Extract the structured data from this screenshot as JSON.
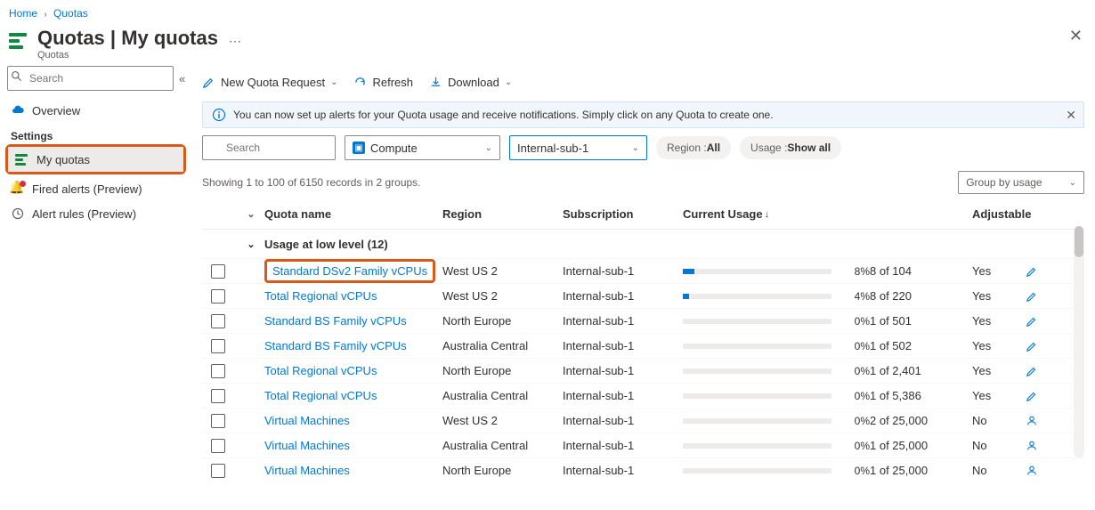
{
  "breadcrumb": {
    "home": "Home",
    "current": "Quotas"
  },
  "header": {
    "title": "Quotas",
    "subtitle_sep": " | ",
    "subtitle": "My quotas",
    "subheader": "Quotas"
  },
  "sidebar": {
    "search_placeholder": "Search",
    "overview": "Overview",
    "settings_header": "Settings",
    "my_quotas": "My quotas",
    "fired_alerts": "Fired alerts (Preview)",
    "alert_rules": "Alert rules (Preview)"
  },
  "toolbar": {
    "new_quota": "New Quota Request",
    "refresh": "Refresh",
    "download": "Download"
  },
  "banner": "You can now set up alerts for your Quota usage and receive notifications. Simply click on any Quota to create one.",
  "filters": {
    "search_placeholder": "Search",
    "category": "Compute",
    "subscription": "Internal-sub-1",
    "region_label": "Region : ",
    "region_value": "All",
    "usage_label": "Usage : ",
    "usage_value": "Show all"
  },
  "records_line": "Showing 1 to 100 of 6150 records in 2 groups.",
  "group_by": "Group by usage",
  "columns": {
    "name": "Quota name",
    "region": "Region",
    "subscription": "Subscription",
    "usage": "Current Usage",
    "adjustable": "Adjustable"
  },
  "group1": "Usage at low level (12)",
  "rows": [
    {
      "name": "Standard DSv2 Family vCPUs",
      "region": "West US 2",
      "sub": "Internal-sub-1",
      "pct": "8%",
      "fill": 8,
      "of": "8 of 104",
      "adj": "Yes",
      "icon": "pencil",
      "hl": true
    },
    {
      "name": "Total Regional vCPUs",
      "region": "West US 2",
      "sub": "Internal-sub-1",
      "pct": "4%",
      "fill": 4,
      "of": "8 of 220",
      "adj": "Yes",
      "icon": "pencil"
    },
    {
      "name": "Standard BS Family vCPUs",
      "region": "North Europe",
      "sub": "Internal-sub-1",
      "pct": "0%",
      "fill": 0,
      "of": "1 of 501",
      "adj": "Yes",
      "icon": "pencil"
    },
    {
      "name": "Standard BS Family vCPUs",
      "region": "Australia Central",
      "sub": "Internal-sub-1",
      "pct": "0%",
      "fill": 0,
      "of": "1 of 502",
      "adj": "Yes",
      "icon": "pencil"
    },
    {
      "name": "Total Regional vCPUs",
      "region": "North Europe",
      "sub": "Internal-sub-1",
      "pct": "0%",
      "fill": 0,
      "of": "1 of 2,401",
      "adj": "Yes",
      "icon": "pencil"
    },
    {
      "name": "Total Regional vCPUs",
      "region": "Australia Central",
      "sub": "Internal-sub-1",
      "pct": "0%",
      "fill": 0,
      "of": "1 of 5,386",
      "adj": "Yes",
      "icon": "pencil"
    },
    {
      "name": "Virtual Machines",
      "region": "West US 2",
      "sub": "Internal-sub-1",
      "pct": "0%",
      "fill": 0,
      "of": "2 of 25,000",
      "adj": "No",
      "icon": "user"
    },
    {
      "name": "Virtual Machines",
      "region": "Australia Central",
      "sub": "Internal-sub-1",
      "pct": "0%",
      "fill": 0,
      "of": "1 of 25,000",
      "adj": "No",
      "icon": "user"
    },
    {
      "name": "Virtual Machines",
      "region": "North Europe",
      "sub": "Internal-sub-1",
      "pct": "0%",
      "fill": 0,
      "of": "1 of 25,000",
      "adj": "No",
      "icon": "user"
    }
  ]
}
